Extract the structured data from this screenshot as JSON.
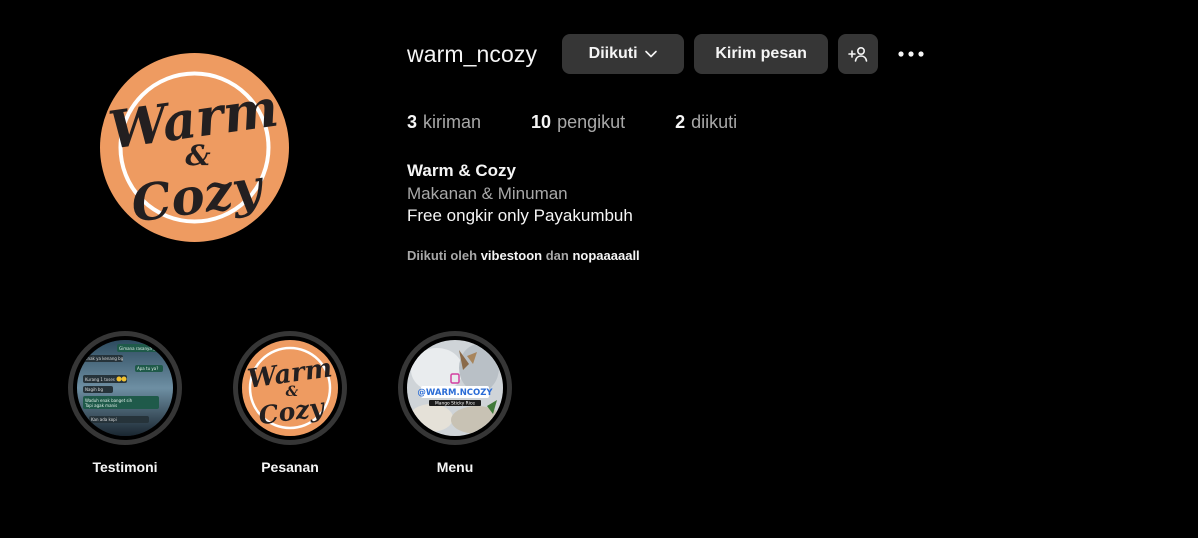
{
  "profile": {
    "username": "warm_ncozy",
    "logo": {
      "line1": "Warm",
      "line2": "&",
      "line3": "Cozy",
      "bg_color": "#EE9B61",
      "ink_color": "#231F20",
      "ring_color": "#FFFFFF"
    }
  },
  "actions": {
    "follow_label": "Diikuti",
    "message_label": "Kirim pesan",
    "suggest_icon": "person-add-icon",
    "more_icon": "more-horizontal-icon"
  },
  "stats": {
    "posts_count": "3",
    "posts_label": "kiriman",
    "followers_count": "10",
    "followers_label": "pengikut",
    "following_count": "2",
    "following_label": "diikuti"
  },
  "bio": {
    "name": "Warm & Cozy",
    "category": "Makanan & Minuman",
    "text": "Free ongkir only Payakumbuh"
  },
  "followed_by": {
    "prefix": "Diikuti oleh",
    "user1": "vibestoon",
    "conjunction": "dan",
    "user2": "nopaaaaall"
  },
  "highlights": [
    {
      "label": "Testimoni",
      "chat_lines": [
        "Gimana rasanya ya?",
        "Enak ya kenang bg",
        "Apa tu ya?",
        "Kurang 1 toses",
        "Nagih bg",
        "Waduh enak banget sih",
        "Tapi agak manis",
        "Kan ada kopi"
      ]
    },
    {
      "label": "Pesanan"
    },
    {
      "label": "Menu",
      "tag": "@WARM.NCOZY",
      "caption": "Mango Sticky Rice"
    }
  ],
  "colors": {
    "background": "#000000",
    "button_bg": "#363636",
    "text_primary": "#F5F5F5",
    "text_secondary": "#A8A8A8"
  }
}
